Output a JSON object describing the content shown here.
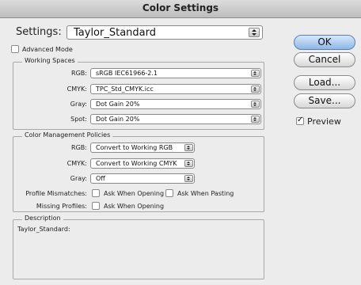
{
  "window": {
    "title": "Color Settings"
  },
  "settings": {
    "label": "Settings:",
    "value": "Taylor_Standard"
  },
  "advanced_mode": {
    "label": "Advanced Mode",
    "checked": false
  },
  "working_spaces": {
    "title": "Working Spaces",
    "rgb": {
      "label": "RGB:",
      "value": "sRGB IEC61966-2.1"
    },
    "cmyk": {
      "label": "CMYK:",
      "value": "TPC_Std_CMYK.icc"
    },
    "gray": {
      "label": "Gray:",
      "value": "Dot Gain 20%"
    },
    "spot": {
      "label": "Spot:",
      "value": "Dot Gain 20%"
    }
  },
  "policies": {
    "title": "Color Management Policies",
    "rgb": {
      "label": "RGB:",
      "value": "Convert to Working RGB"
    },
    "cmyk": {
      "label": "CMYK:",
      "value": "Convert to Working CMYK"
    },
    "gray": {
      "label": "Gray:",
      "value": "Off"
    },
    "profile_mismatches": {
      "label": "Profile Mismatches:",
      "opening": "Ask When Opening",
      "pasting": "Ask When Pasting"
    },
    "missing_profiles": {
      "label": "Missing Profiles:",
      "opening": "Ask When Opening"
    }
  },
  "description": {
    "title": "Description",
    "text": "Taylor_Standard:"
  },
  "buttons": {
    "ok": "OK",
    "cancel": "Cancel",
    "load": "Load...",
    "save": "Save..."
  },
  "preview": {
    "label": "Preview",
    "checked": true
  }
}
